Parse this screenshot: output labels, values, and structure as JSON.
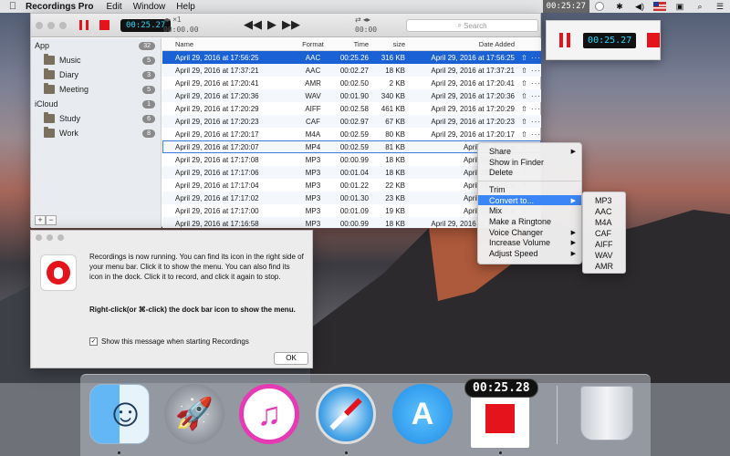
{
  "menubar": {
    "app_name": "Recordings Pro",
    "menus": [
      "Edit",
      "Window",
      "Help"
    ],
    "timer": "00:25:27",
    "icons": [
      "record-dot-icon",
      "bluetooth-icon",
      "volume-icon",
      "flag-icon",
      "lock-icon",
      "search-icon",
      "list-icon"
    ]
  },
  "toolbar": {
    "timer": "00:25.27",
    "speed": "×1",
    "position": "00:00.00",
    "duration": "00:00",
    "search_placeholder": "Search"
  },
  "sidebar": {
    "sections": [
      {
        "label": "App",
        "count": "32",
        "items": [
          {
            "label": "Music",
            "count": "5"
          },
          {
            "label": "Diary",
            "count": "3"
          },
          {
            "label": "Meeting",
            "count": "5"
          }
        ]
      },
      {
        "label": "iCloud",
        "count": "1",
        "items": [
          {
            "label": "Study",
            "count": "6"
          },
          {
            "label": "Work",
            "count": "8"
          }
        ]
      }
    ],
    "add_label": "+",
    "remove_label": "−"
  },
  "table": {
    "headers": {
      "name": "Name",
      "format": "Format",
      "time": "Time",
      "size": "size",
      "date": "Date Added"
    },
    "rows": [
      {
        "name": "April 29, 2016 at 17:56:25",
        "format": "AAC",
        "time": "00:25.26",
        "size": "316 KB",
        "date": "April 29, 2016 at 17:56:25"
      },
      {
        "name": "April 29, 2016 at 17:37:21",
        "format": "AAC",
        "time": "00:02.27",
        "size": "18 KB",
        "date": "April 29, 2016 at 17:37:21"
      },
      {
        "name": "April 29, 2016 at 17:20:41",
        "format": "AMR",
        "time": "00:02.50",
        "size": "2 KB",
        "date": "April 29, 2016 at 17:20:41"
      },
      {
        "name": "April 29, 2016 at 17:20:36",
        "format": "WAV",
        "time": "00:01.90",
        "size": "340 KB",
        "date": "April 29, 2016 at 17:20:36"
      },
      {
        "name": "April 29, 2016 at 17:20:29",
        "format": "AIFF",
        "time": "00:02.58",
        "size": "461 KB",
        "date": "April 29, 2016 at 17:20:29"
      },
      {
        "name": "April 29, 2016 at 17:20:23",
        "format": "CAF",
        "time": "00:02.97",
        "size": "67 KB",
        "date": "April 29, 2016 at 17:20:23"
      },
      {
        "name": "April 29, 2016 at 17:20:17",
        "format": "M4A",
        "time": "00:02.59",
        "size": "80 KB",
        "date": "April 29, 2016 at 17:20:17"
      },
      {
        "name": "April 29, 2016 at 17:20:07",
        "format": "MP4",
        "time": "00:02.59",
        "size": "81 KB",
        "date": "April 29, 2016 a"
      },
      {
        "name": "April 29, 2016 at 17:17:08",
        "format": "MP3",
        "time": "00:00.99",
        "size": "18 KB",
        "date": "April 29, 2016 a"
      },
      {
        "name": "April 29, 2016 at 17:17:06",
        "format": "MP3",
        "time": "00:01.04",
        "size": "18 KB",
        "date": "April 29, 2016 a"
      },
      {
        "name": "April 29, 2016 at 17:17:04",
        "format": "MP3",
        "time": "00:01.22",
        "size": "22 KB",
        "date": "April 29, 2016 a"
      },
      {
        "name": "April 29, 2016 at 17:17:02",
        "format": "MP3",
        "time": "00:01.30",
        "size": "23 KB",
        "date": "April 29, 2016 a"
      },
      {
        "name": "April 29, 2016 at 17:17:00",
        "format": "MP3",
        "time": "00:01.09",
        "size": "19 KB",
        "date": "April 29, 2016 a"
      },
      {
        "name": "April 29, 2016 at 17:16:58",
        "format": "MP3",
        "time": "00:00.99",
        "size": "18 KB",
        "date": "April 29, 2016 at 17:16:58"
      }
    ],
    "row_actions": "⇧ ···"
  },
  "mini_window": {
    "timer": "00:25.27"
  },
  "context_menu": {
    "items": [
      {
        "label": "Share",
        "submenu": true
      },
      {
        "label": "Show in Finder",
        "submenu": false
      },
      {
        "label": "Delete",
        "submenu": false
      },
      {
        "separator": true
      },
      {
        "label": "Trim",
        "submenu": false
      },
      {
        "label": "Convert to...",
        "submenu": true,
        "highlighted": true
      },
      {
        "label": "Mix",
        "submenu": false
      },
      {
        "label": "Make a Ringtone",
        "submenu": false
      },
      {
        "label": "Voice Changer",
        "submenu": true
      },
      {
        "label": "Increase Volume",
        "submenu": true
      },
      {
        "label": "Adjust Speed",
        "submenu": true
      }
    ],
    "convert_options": [
      "MP3",
      "AAC",
      "M4A",
      "CAF",
      "AIFF",
      "WAV",
      "AMR"
    ]
  },
  "dialog": {
    "message": "Recordings is now running. You can find its icon in the right side of your menu bar. Click it to show the menu. You can also find its icon in the dock. Click it to record, and click it again to stop.",
    "hint": "Right-click(or ⌘-click) the dock bar icon to show the menu.",
    "checkbox_label": "Show this message when starting Recordings",
    "checkbox_checked": "✓",
    "ok_label": "OK"
  },
  "dock": {
    "timer": "00:25.28",
    "apps": [
      "finder-icon",
      "launchpad-icon",
      "itunes-icon",
      "safari-icon",
      "app-store-icon",
      "recordings-icon",
      "trash-icon"
    ]
  },
  "colors": {
    "record_red": "#e5141c",
    "timer_cyan": "#22d9ff",
    "selection_blue": "#1b61d6",
    "menu_highlight": "#3b86f7"
  }
}
